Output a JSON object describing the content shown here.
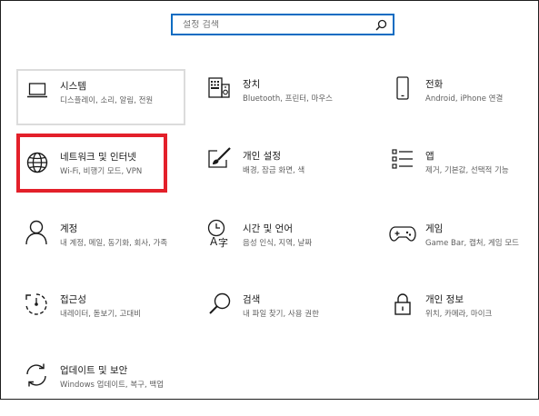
{
  "search": {
    "placeholder": "설정 검색"
  },
  "colors": {
    "accent": "#0a6cc2",
    "highlight": "#e3202a",
    "icon": "#0063b1"
  },
  "tiles": [
    {
      "id": "system",
      "icon": "monitor-icon",
      "title": "시스템",
      "subtitle": "디스플레이, 소리, 알림, 전원"
    },
    {
      "id": "devices",
      "icon": "keyboard-speaker-icon",
      "title": "장치",
      "subtitle": "Bluetooth, 프린터, 마우스"
    },
    {
      "id": "phone",
      "icon": "phone-icon",
      "title": "전화",
      "subtitle": "Android, iPhone 연결"
    },
    {
      "id": "network",
      "icon": "globe-icon",
      "title": "네트워크 및 인터넷",
      "subtitle": "Wi-Fi, 비행기 모드, VPN"
    },
    {
      "id": "personalization",
      "icon": "paint-brush-icon",
      "title": "개인 설정",
      "subtitle": "배경, 잠금 화면, 색"
    },
    {
      "id": "apps",
      "icon": "apps-list-icon",
      "title": "앱",
      "subtitle": "제거, 기본값, 선택적 기능"
    },
    {
      "id": "accounts",
      "icon": "person-icon",
      "title": "계정",
      "subtitle": "내 계정, 메일, 동기화, 회사, 가족"
    },
    {
      "id": "time-language",
      "icon": "time-language-icon",
      "title": "시간 및 언어",
      "subtitle": "음성 인식, 지역, 날짜"
    },
    {
      "id": "gaming",
      "icon": "gamepad-icon",
      "title": "게임",
      "subtitle": "Game Bar, 캡처, 게임 모드"
    },
    {
      "id": "ease-of-access",
      "icon": "ease-of-access-icon",
      "title": "접근성",
      "subtitle": "내레이터, 돋보기, 고대비"
    },
    {
      "id": "search",
      "icon": "magnifier-icon",
      "title": "검색",
      "subtitle": "내 파일 찾기, 사용 권한"
    },
    {
      "id": "privacy",
      "icon": "lock-icon",
      "title": "개인 정보",
      "subtitle": "위치, 카메라, 마이크"
    },
    {
      "id": "update-security",
      "icon": "sync-icon",
      "title": "업데이트 및 보안",
      "subtitle": "Windows 업데이트, 복구, 백업"
    }
  ]
}
